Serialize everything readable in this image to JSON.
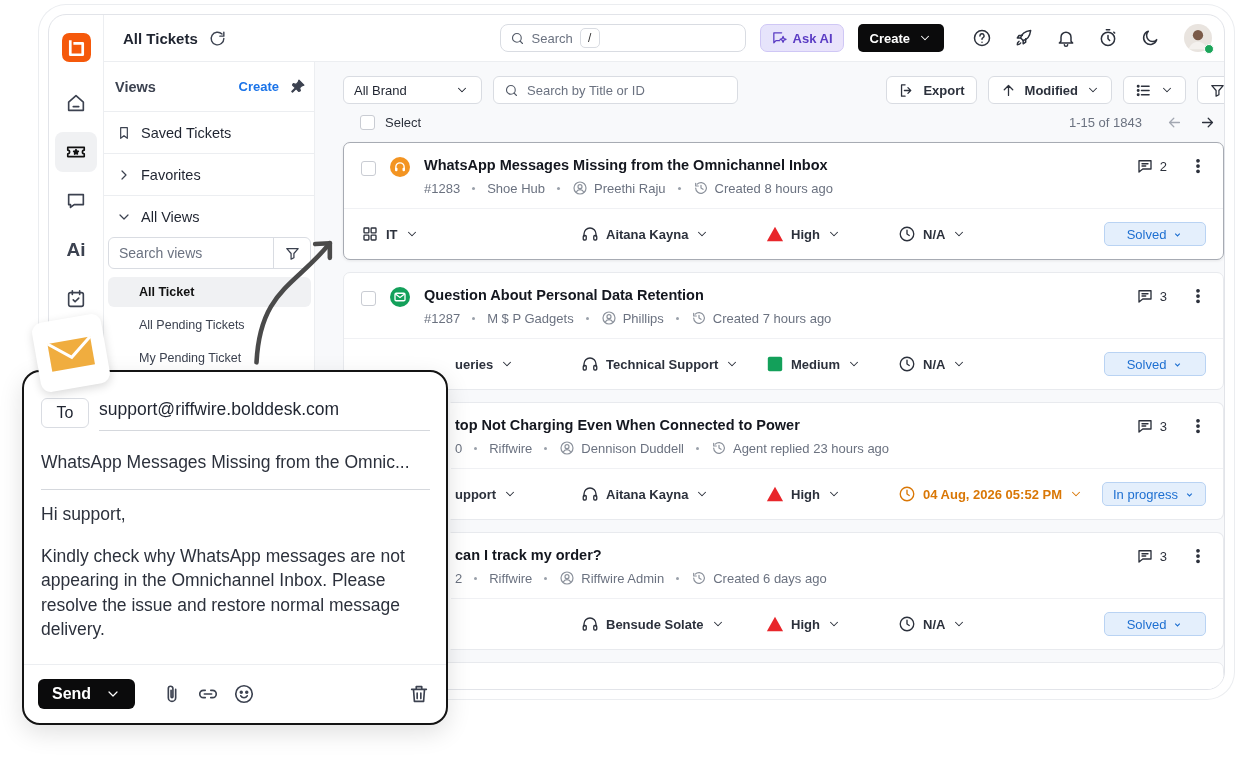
{
  "rail": [
    {
      "kind": "home",
      "selected": false
    },
    {
      "kind": "ticket",
      "selected": true
    },
    {
      "kind": "chat",
      "selected": false
    },
    {
      "kind": "text",
      "label": "Ai",
      "selected": false
    },
    {
      "kind": "calendar",
      "selected": false
    }
  ],
  "header": {
    "title": "All Tickets",
    "search": {
      "placeholder": "Search",
      "shortcut": "/"
    },
    "ask_ai": "Ask AI",
    "create": "Create",
    "user_online": true
  },
  "views": {
    "title": "Views",
    "create": "Create",
    "sections": [
      {
        "label": "Saved Tickets",
        "kind": "bookmark"
      },
      {
        "label": "Favorites",
        "kind": "group",
        "expanded": false
      },
      {
        "label": "All Views",
        "kind": "group",
        "expanded": true
      }
    ],
    "search": {
      "placeholder": "Search views"
    },
    "items": [
      {
        "label": "All Ticket",
        "selected": true
      },
      {
        "label": "All Pending Tickets",
        "selected": false
      },
      {
        "label": "My Pending Ticket",
        "selected": false
      }
    ]
  },
  "toolbar": {
    "brand": "All Brand",
    "search": {
      "placeholder": "Search by Title or ID"
    },
    "export": "Export",
    "sort": "Modified"
  },
  "select": {
    "label": "Select",
    "checked": false
  },
  "pagination": "1-15 of 1843",
  "tickets": [
    {
      "selected": true,
      "checked": false,
      "channel": {
        "kind": "phone"
      },
      "title": "WhatsApp Messages Missing from the Omnichannel Inbox",
      "id": "#1283",
      "org": "Shoe Hub",
      "contact": "Preethi Raju",
      "time": "Created 8 hours ago",
      "comments": "2",
      "category": {
        "kind": "full",
        "label": "IT"
      },
      "assignee": "Aitana Kayna",
      "priority": {
        "kind": "high",
        "label": "High"
      },
      "due": "N/A",
      "overdue": false,
      "status": "Solved"
    },
    {
      "selected": false,
      "checked": false,
      "channel": {
        "kind": "email"
      },
      "title": "Question About Personal Data Retention",
      "id": "#1287",
      "org": "M $ P Gadgets",
      "contact": "Phillips",
      "time": "Created 7 hours ago",
      "comments": "3",
      "category": {
        "kind": "partial",
        "label": "ueries"
      },
      "assignee": "Technical Support",
      "priority": {
        "kind": "medium",
        "label": "Medium"
      },
      "due": "N/A",
      "overdue": false,
      "status": "Solved"
    },
    {
      "selected": false,
      "title": "top Not Charging Even When Connected to Power",
      "id": "0",
      "org": "Riffwire",
      "contact": "Dennison Duddell",
      "time": "Agent replied 23 hours ago",
      "comments": "3",
      "category": {
        "kind": "partial",
        "label": "upport"
      },
      "assignee": "Aitana Kayna",
      "priority": {
        "kind": "high",
        "label": "High"
      },
      "due": "04 Aug, 2026 05:52 PM",
      "overdue": true,
      "status": "In progress"
    },
    {
      "selected": false,
      "title": "can I track my order?",
      "id": "2",
      "org": "Riffwire",
      "contact": "Riffwire Admin",
      "time": "Created 6 days ago",
      "comments": "3",
      "assignee": "Bensude Solate",
      "priority": {
        "kind": "high",
        "label": "High"
      },
      "due": "N/A",
      "overdue": false,
      "status": "Solved"
    }
  ],
  "compose": {
    "to_label": "To",
    "to": "support@riffwire.bolddesk.com",
    "subject": "WhatsApp Messages Missing from the Omnic...",
    "greeting": "Hi support,",
    "body": "Kindly check why WhatsApp messages are not appearing in the Omnichannel Inbox. Please resolve the issue and restore normal message delivery.",
    "send": "Send"
  }
}
